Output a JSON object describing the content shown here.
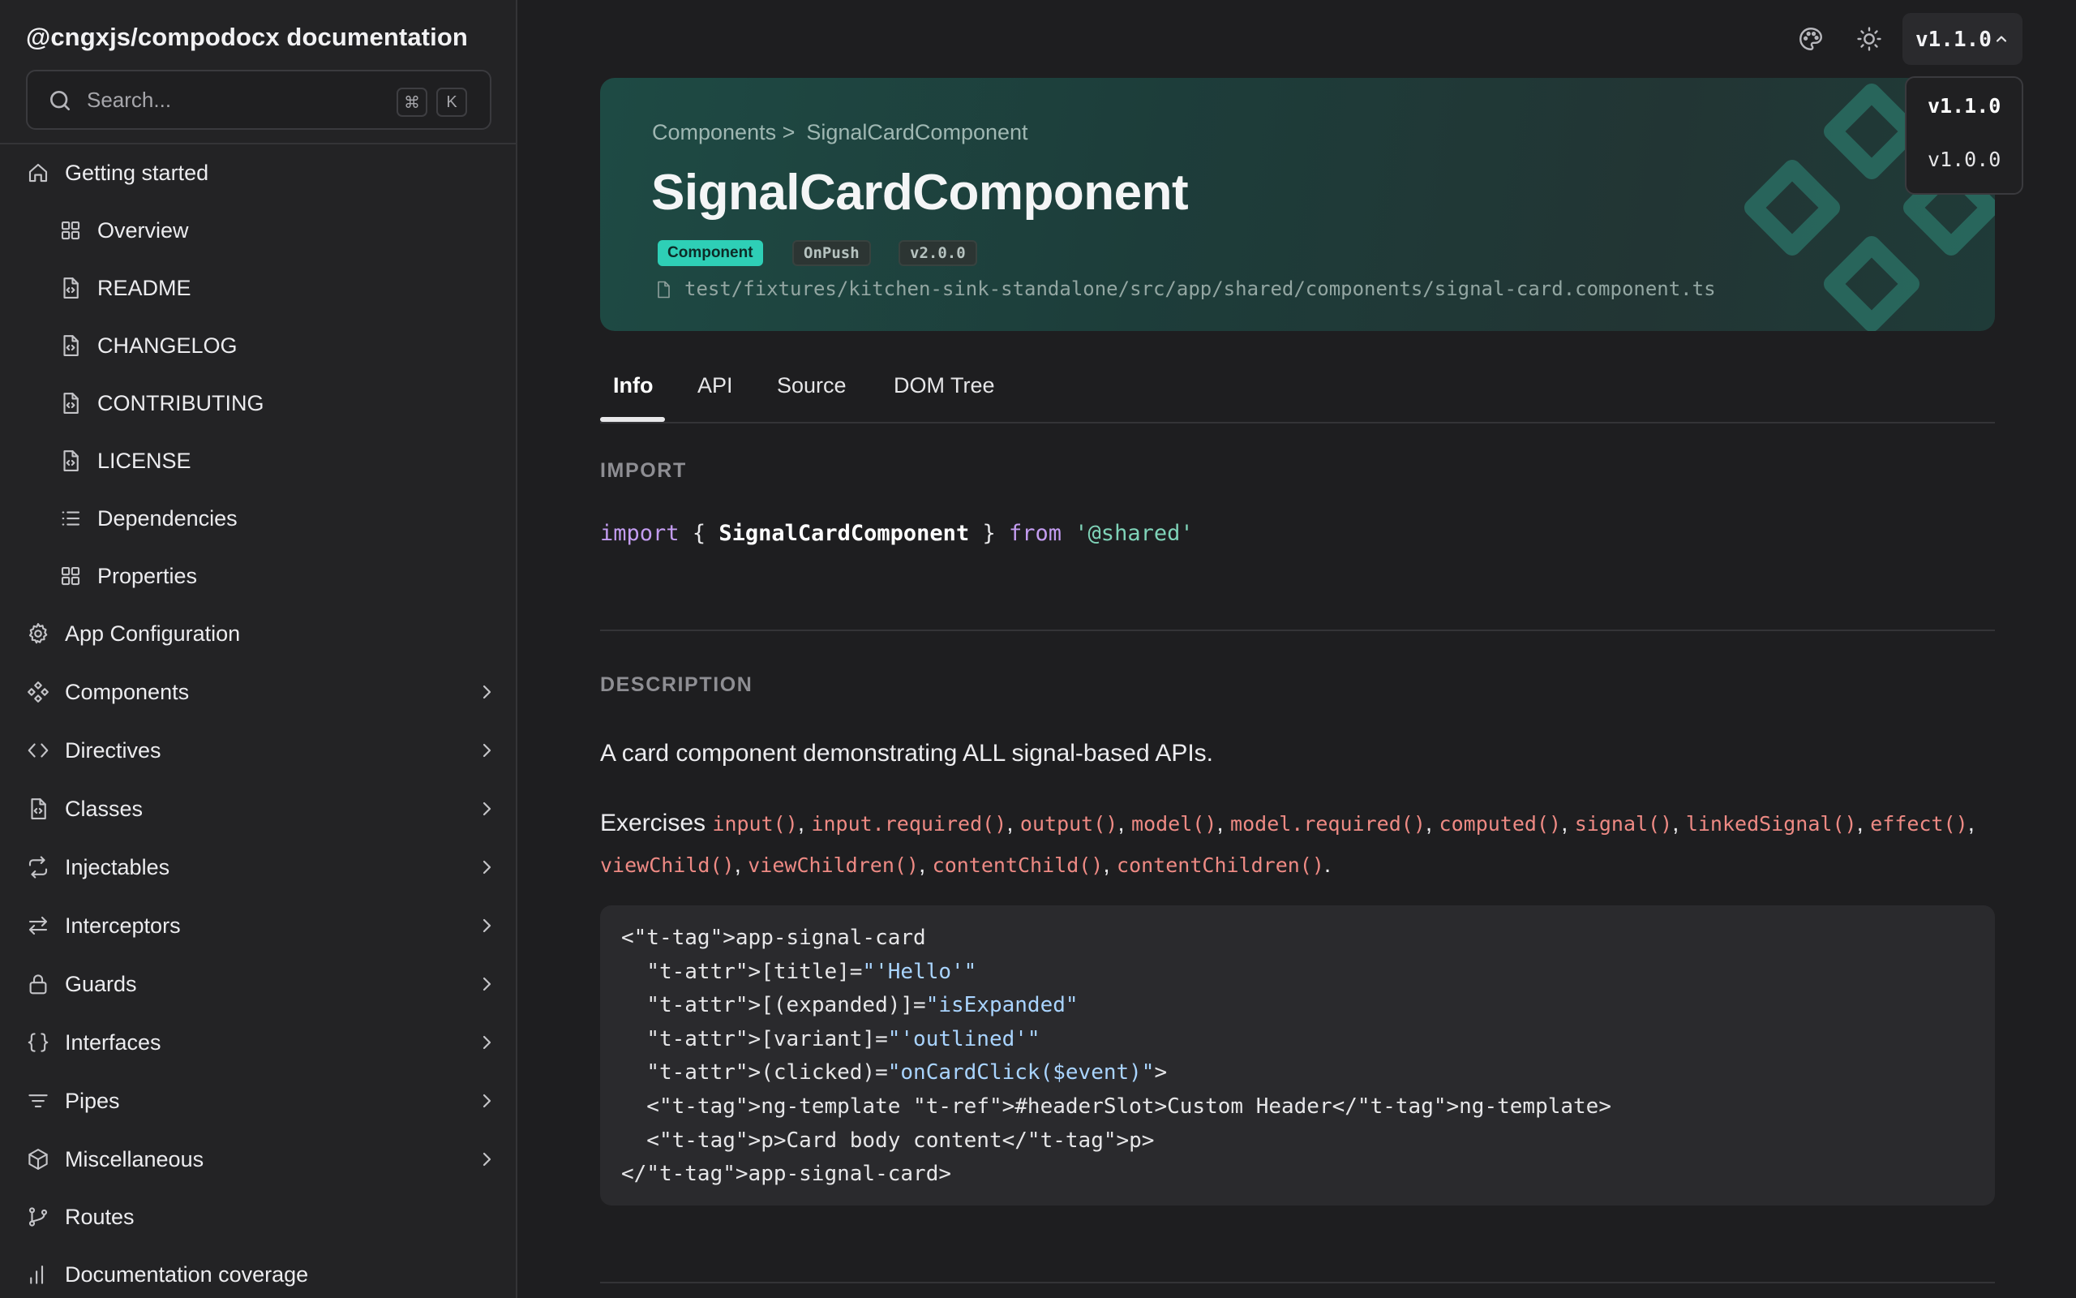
{
  "sidebar": {
    "title": "@cngxjs/compodocx documentation",
    "search": {
      "placeholder": "Search...",
      "shortcut_mod": "⌘",
      "shortcut_key": "K"
    },
    "items": [
      {
        "label": "Getting started",
        "icon": "home-icon",
        "level": "top",
        "expandable": false
      },
      {
        "label": "Overview",
        "icon": "grid-icon",
        "level": "sub",
        "expandable": false
      },
      {
        "label": "README",
        "icon": "file-code-icon",
        "level": "sub",
        "expandable": false
      },
      {
        "label": "CHANGELOG",
        "icon": "file-code-icon",
        "level": "sub",
        "expandable": false
      },
      {
        "label": "CONTRIBUTING",
        "icon": "file-code-icon",
        "level": "sub",
        "expandable": false
      },
      {
        "label": "LICENSE",
        "icon": "file-code-icon",
        "level": "sub",
        "expandable": false
      },
      {
        "label": "Dependencies",
        "icon": "list-icon",
        "level": "sub",
        "expandable": false
      },
      {
        "label": "Properties",
        "icon": "grid-icon",
        "level": "sub",
        "expandable": false
      },
      {
        "label": "App Configuration",
        "icon": "gear-icon",
        "level": "top",
        "expandable": false
      },
      {
        "label": "Components",
        "icon": "components-icon",
        "level": "top",
        "expandable": true
      },
      {
        "label": "Directives",
        "icon": "code-brackets-icon",
        "level": "top",
        "expandable": true
      },
      {
        "label": "Classes",
        "icon": "file-code-icon",
        "level": "top",
        "expandable": true
      },
      {
        "label": "Injectables",
        "icon": "repeat-icon",
        "level": "top",
        "expandable": true
      },
      {
        "label": "Interceptors",
        "icon": "arrows-swap-icon",
        "level": "top",
        "expandable": true
      },
      {
        "label": "Guards",
        "icon": "lock-icon",
        "level": "top",
        "expandable": true
      },
      {
        "label": "Interfaces",
        "icon": "braces-icon",
        "level": "top",
        "expandable": true
      },
      {
        "label": "Pipes",
        "icon": "filter-icon",
        "level": "top",
        "expandable": true
      },
      {
        "label": "Miscellaneous",
        "icon": "box-icon",
        "level": "top",
        "expandable": true
      },
      {
        "label": "Routes",
        "icon": "git-branch-icon",
        "level": "top",
        "expandable": false
      },
      {
        "label": "Documentation coverage",
        "icon": "bar-chart-icon",
        "level": "top",
        "expandable": false
      }
    ]
  },
  "topbar": {
    "palette_icon": "palette-icon",
    "theme_icon": "sun-icon",
    "version_selected": "v1.1.0",
    "version_options": [
      "v1.1.0",
      "v1.0.0"
    ]
  },
  "hero": {
    "breadcrumb_parent": "Components >",
    "breadcrumb_current": "SignalCardComponent",
    "title": "SignalCardComponent",
    "badges": {
      "type": "Component",
      "change_detection": "OnPush",
      "version": "v2.0.0"
    },
    "file_path": "test/fixtures/kitchen-sink-standalone/src/app/shared/components/signal-card.component.ts"
  },
  "tabs": [
    "Info",
    "API",
    "Source",
    "DOM Tree"
  ],
  "active_tab": "Info",
  "import_section": {
    "label": "IMPORT",
    "kw_import": "import",
    "brace_open": "{",
    "symbol": "SignalCardComponent",
    "brace_close": "}",
    "kw_from": "from",
    "module": "'@shared'"
  },
  "description_section": {
    "label": "DESCRIPTION",
    "summary": "A card component demonstrating ALL signal-based APIs.",
    "exercises_prefix": "Exercises",
    "apis": [
      "input()",
      "input.required()",
      "output()",
      "model()",
      "model.required()",
      "computed()",
      "signal()",
      "linkedSignal()",
      "effect()",
      "viewChild()",
      "viewChildren()",
      "contentChild()",
      "contentChildren()"
    ],
    "code_lines": [
      "<app-signal-card",
      "  [title]=\"'Hello'\"",
      "  [(expanded)]=\"isExpanded\"",
      "  [variant]=\"'outlined'\"",
      "  (clicked)=\"onCardClick($event)\">",
      "  <ng-template #headerSlot>Custom Header</ng-template>",
      "  <p>Card body content</p>",
      "</app-signal-card>"
    ]
  },
  "colors": {
    "background": "#1e1e20",
    "sidebar": "#232325",
    "accent": "#2ecfb6",
    "code_fn": "#ee8a84",
    "keyword": "#c39cf0",
    "string": "#7fd3b8"
  }
}
